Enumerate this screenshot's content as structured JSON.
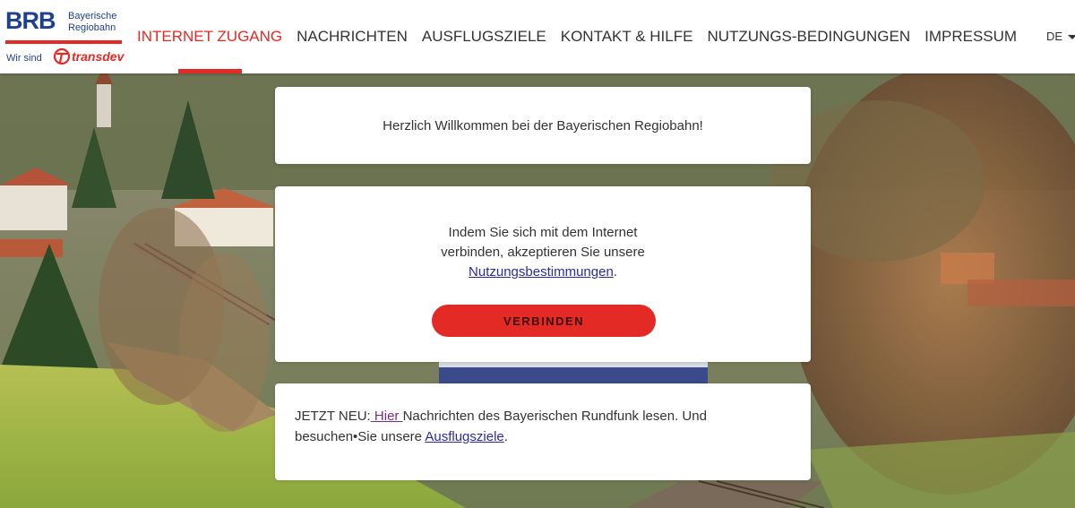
{
  "logo": {
    "brb": "BRB",
    "sub_line1": "Bayerische",
    "sub_line2": "Regiobahn",
    "wir_sind": "Wir sind",
    "partner": "transdev"
  },
  "nav": {
    "items": [
      {
        "label": "INTERNET ZUGANG",
        "active": true
      },
      {
        "label": "NACHRICHTEN",
        "active": false
      },
      {
        "label": "AUSFLUGSZIELE",
        "active": false
      },
      {
        "label": "KONTAKT & HILFE",
        "active": false
      },
      {
        "label": "NUTZUNGS-BEDINGUNGEN",
        "active": false
      },
      {
        "label": "IMPRESSUM",
        "active": false
      }
    ],
    "language": "DE"
  },
  "welcome": {
    "text": "Herzlich Willkommen bei der Bayerischen Regiobahn!"
  },
  "connect": {
    "text_line1": "Indem Sie sich mit dem Internet",
    "text_line2": "verbinden, akzeptieren Sie unsere",
    "terms_link": "Nutzungsbestimmungen",
    "terms_suffix": ".",
    "button_label": "VERBINDEN"
  },
  "news": {
    "prefix": "JETZT NEU:",
    "here_link": " Hier ",
    "middle": "Nachrichten des Bayerischen Rundfunk lesen. Und",
    "line2_prefix": "besuchen•Sie unsere ",
    "destinations_link": "Ausflugsziele",
    "suffix": "."
  },
  "colors": {
    "accent": "#e42a24",
    "brand_blue": "#1f3f8f",
    "link": "#2a2aa8"
  }
}
